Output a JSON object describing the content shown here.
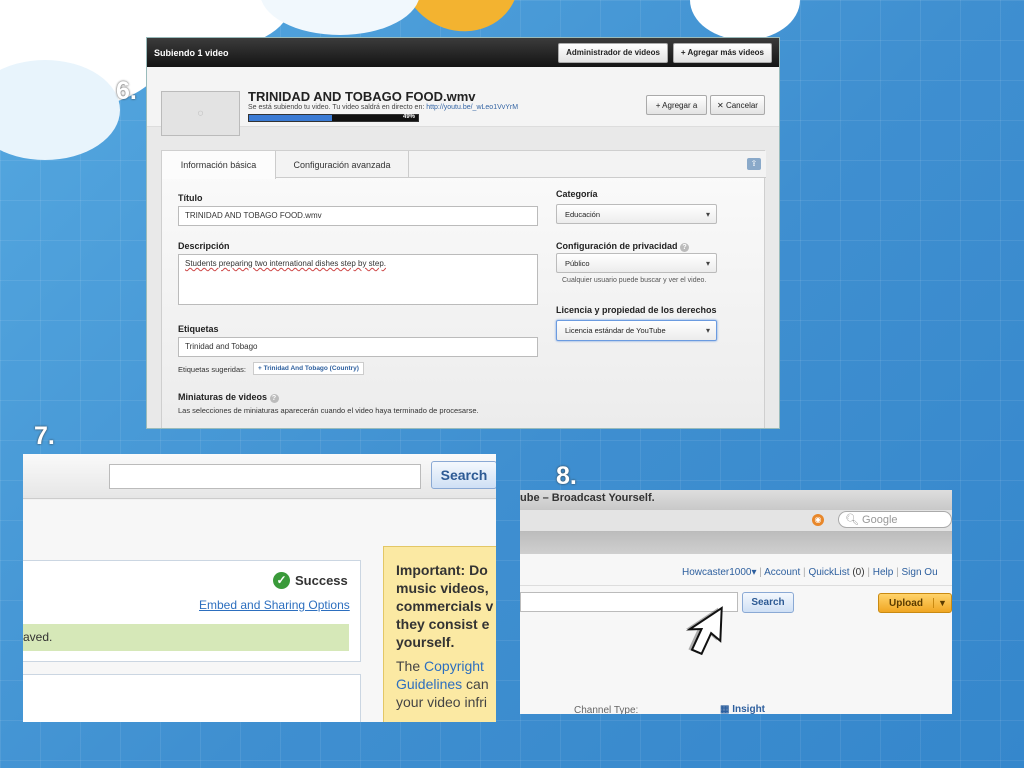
{
  "steps": {
    "s6": "6.",
    "s7": "7.",
    "s8": "8."
  },
  "panel6": {
    "header_title": "Subiendo 1 video",
    "btn_admin": "Administrador de videos",
    "btn_add": "+  Agregar más videos",
    "video_title": "TRINIDAD AND TOBAGO FOOD.wmv",
    "status_text": "Se está subiendo tu video. Tu video saldrá en directo en:",
    "status_link": "http://youtu.be/_wLeo1VvYrM",
    "progress": 0.49,
    "progress_label": "49%",
    "btn_add_to": "+ Agregar a",
    "btn_cancel": "✕  Cancelar",
    "tab_basic": "Información básica",
    "tab_advanced": "Configuración avanzada",
    "title_label": "Título",
    "title_value": "TRINIDAD AND TOBAGO FOOD.wmv",
    "desc_label": "Descripción",
    "desc_value": "Students preparing two international dishes step by step.",
    "tags_label": "Etiquetas",
    "tags_value": "Trinidad and Tobago",
    "suggested_label": "Etiquetas sugeridas:",
    "suggested_tag": "+ Trinidad And Tobago (Country)",
    "thumbs_label": "Miniaturas de videos",
    "thumbs_note": "Las selecciones de miniaturas aparecerán cuando el video haya terminado de procesarse.",
    "category_label": "Categoría",
    "category_value": "Educación",
    "privacy_label": "Configuración de privacidad",
    "privacy_value": "Público",
    "privacy_note": "Cualquier usuario puede buscar y ver el video.",
    "license_label": "Licencia y propiedad de los derechos",
    "license_value": "Licencia estándar de YouTube"
  },
  "panel7": {
    "search_btn": "Search",
    "success": "Success",
    "embed_link": "Embed and Sharing Options",
    "saved": "aved.",
    "important_lines": [
      "Important: Do",
      "music videos,",
      "commercials v",
      "they consist e",
      "yourself."
    ],
    "copyright_line1_a": "The ",
    "copyright_line1_b": "Copyright",
    "copyright_line2_a": "Guidelines",
    "copyright_line2_b": " can",
    "copyright_line3": "your video infri"
  },
  "panel8": {
    "window_title": "ube – Broadcast Yourself.",
    "google_placeholder": "Google",
    "user": "Howcaster1000▾",
    "account": "Account",
    "quicklist": "QuickList",
    "quicklist_count": "(0)",
    "help": "Help",
    "signout": "Sign Ou",
    "search_btn": "Search",
    "upload_btn": "Upload",
    "channel_type": "Channel Type:",
    "insight": "Insight"
  },
  "colors": {
    "accent": "#3b7bd4",
    "upload": "#f0a623",
    "success": "#3a9a3a",
    "important_bg": "#fbe9a3"
  }
}
